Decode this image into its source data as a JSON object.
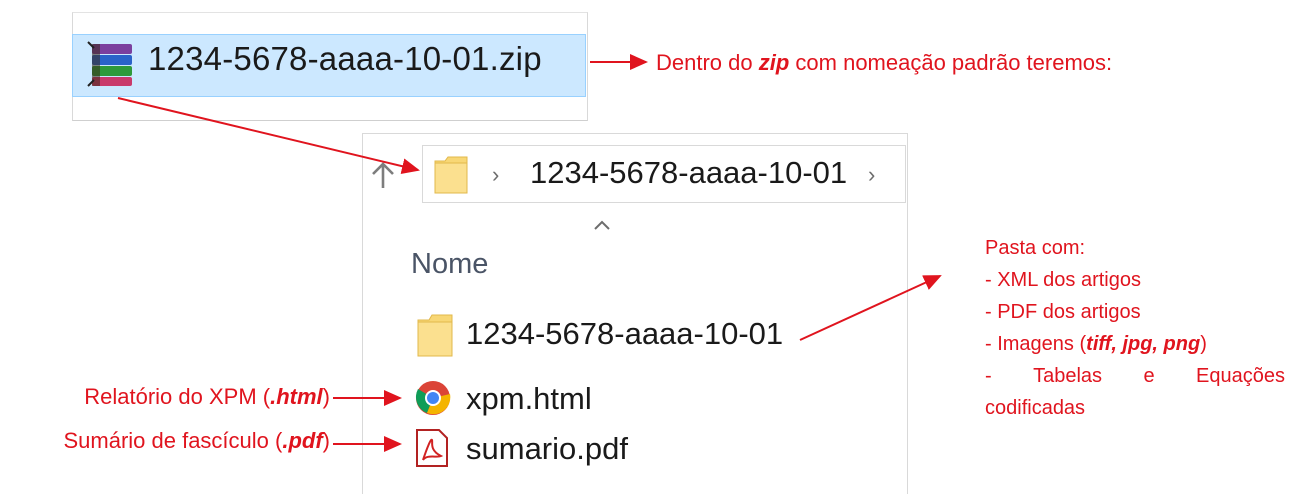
{
  "zip": {
    "filename": "1234-5678-aaaa-10-01.zip",
    "icon": "winrar-archive-icon"
  },
  "annotations": {
    "zip_note_prefix": "Dentro do ",
    "zip_note_emph": "zip",
    "zip_note_suffix": " com nomeação padrão teremos:",
    "folder_note_title": "Pasta com:",
    "folder_note_items": [
      "- XML dos artigos",
      "- PDF dos artigos"
    ],
    "folder_note_images_prefix": "- Imagens (",
    "folder_note_images_emph": "tiff, jpg, png",
    "folder_note_images_suffix": ")",
    "folder_note_tables_words": [
      "-",
      "Tabelas",
      "e",
      "Equações"
    ],
    "folder_note_tables_line2": "codificadas",
    "xpm_note_prefix": "Relatório do XPM (",
    "xpm_note_emph": ".html",
    "xpm_note_suffix": ")",
    "sumario_note_prefix": "Sumário de fascículo (",
    "sumario_note_emph": ".pdf",
    "sumario_note_suffix": ")",
    "color": "#e0141e"
  },
  "explorer": {
    "up_icon": "up-arrow-icon",
    "breadcrumb": {
      "folder_icon": "folder-icon",
      "current": "1234-5678-aaaa-10-01"
    },
    "column_header": "Nome",
    "files": [
      {
        "name": "1234-5678-aaaa-10-01",
        "icon": "folder-icon"
      },
      {
        "name": "xpm.html",
        "icon": "chrome-icon"
      },
      {
        "name": "sumario.pdf",
        "icon": "pdf-icon"
      }
    ]
  }
}
